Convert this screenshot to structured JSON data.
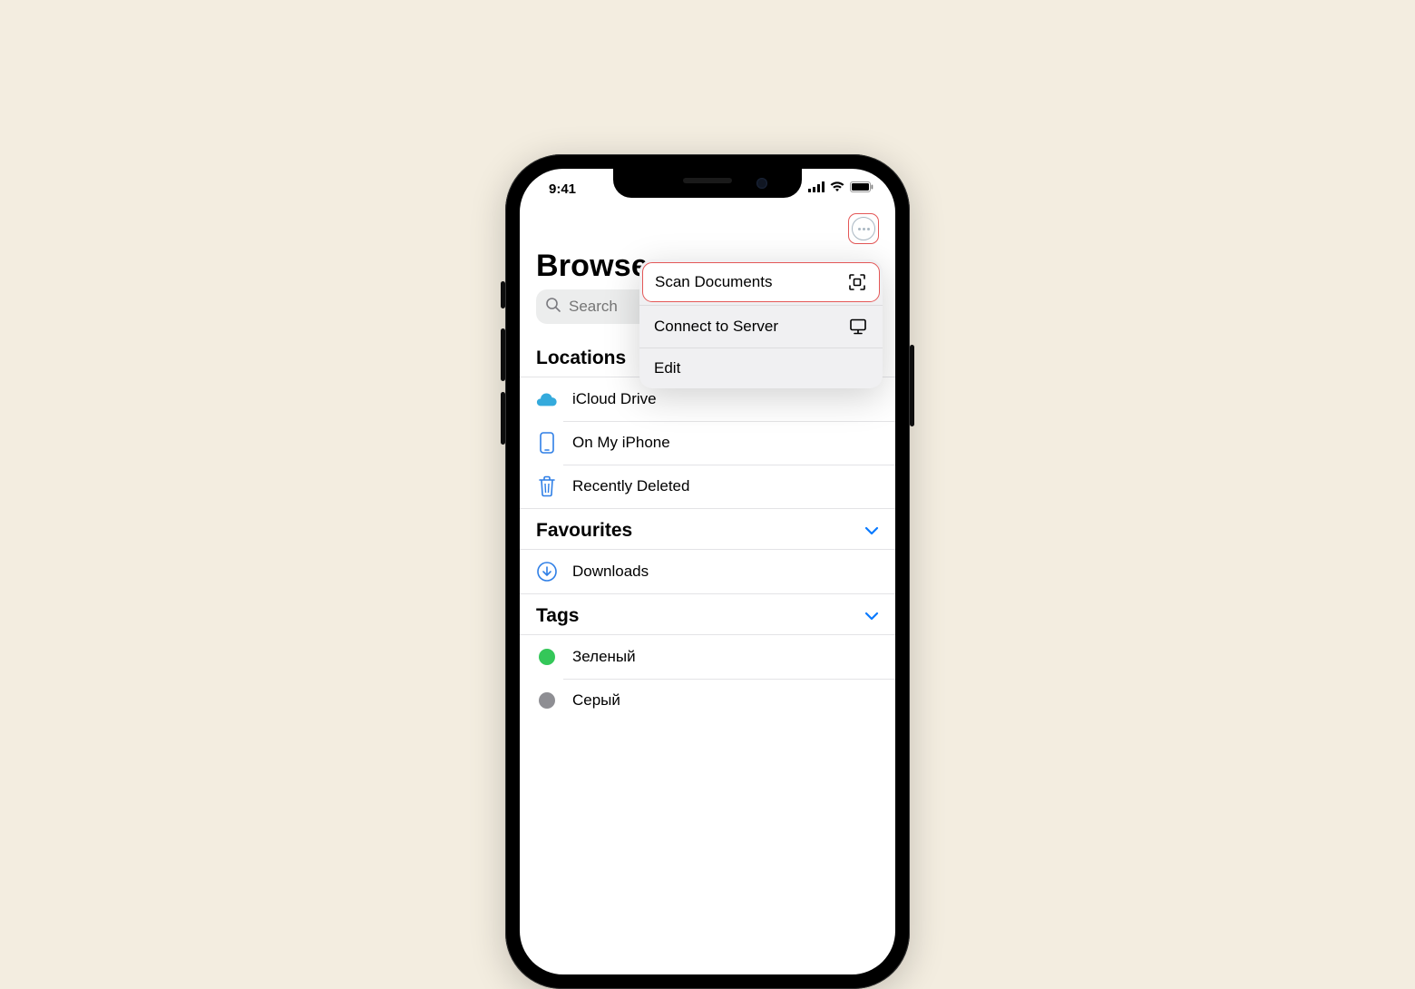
{
  "status": {
    "time": "9:41"
  },
  "page": {
    "title": "Browse",
    "search_placeholder": "Search"
  },
  "menu": {
    "scan": "Scan Documents",
    "connect": "Connect to Server",
    "edit": "Edit"
  },
  "sections": {
    "locations": {
      "title": "Locations",
      "items": [
        {
          "label": "iCloud Drive"
        },
        {
          "label": "On My iPhone"
        },
        {
          "label": "Recently Deleted"
        }
      ]
    },
    "favourites": {
      "title": "Favourites",
      "items": [
        {
          "label": "Downloads"
        }
      ]
    },
    "tags": {
      "title": "Tags",
      "items": [
        {
          "label": "Зеленый",
          "color": "green"
        },
        {
          "label": "Серый",
          "color": "grey"
        }
      ]
    }
  }
}
